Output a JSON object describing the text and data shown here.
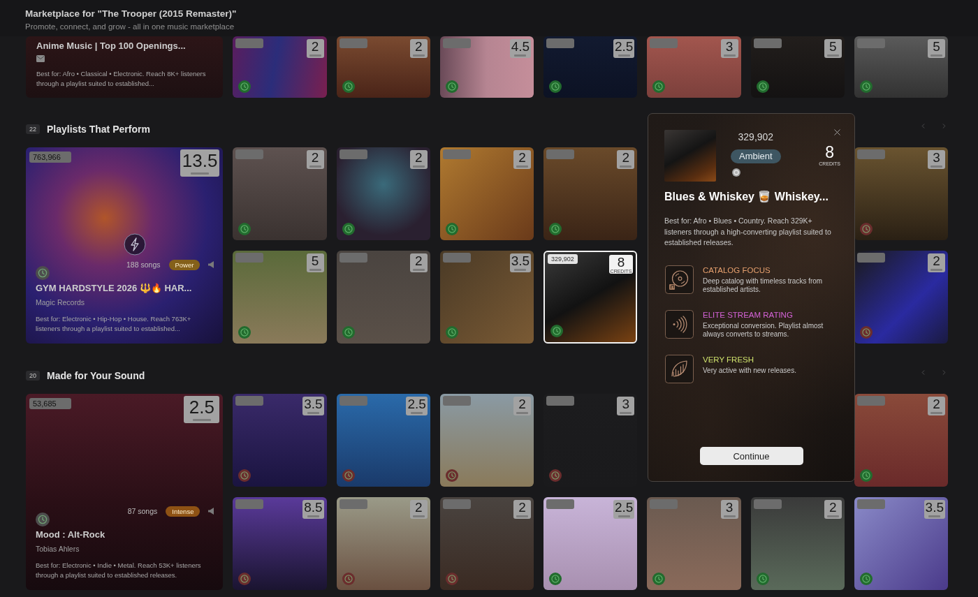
{
  "header": {
    "title": "Marketplace for \"The Trooper (2015 Remaster)\"",
    "subtitle": "Promote, connect, and grow - all in one music marketplace"
  },
  "top_row": {
    "feature": {
      "title": "Anime Music | Top 100 Openings...",
      "description": "Best for: Afro • Classical • Electronic. Reach 8K+ listeners through a playlist suited to established...",
      "selected": false
    },
    "cards": [
      {
        "credits": "2",
        "color": "#226b2e",
        "selected": false
      },
      {
        "credits": "2",
        "color": "#226b2e",
        "selected": false
      },
      {
        "credits": "4.5",
        "color": "#226b2e",
        "selected": false
      },
      {
        "credits": "2.5",
        "color": "#226b2e",
        "selected": false
      },
      {
        "credits": "3",
        "color": "#226b2e",
        "selected": false
      },
      {
        "credits": "5",
        "color": "#226b2e",
        "selected": false
      },
      {
        "credits": "5",
        "color": "#226b2e",
        "selected": false
      }
    ]
  },
  "sections": [
    {
      "count": "22",
      "title": "Playlists That Perform",
      "feature": {
        "count": "763,966",
        "credits": "13.5",
        "boost": true,
        "songs": "188 songs",
        "tag": {
          "label": "Power",
          "color": "#84601a"
        },
        "title": "GYM HARDSTYLE 2026 🔱🔥 HAR...",
        "owner": "Magic Records",
        "description": "Best for: Electronic • Hip-Hop • House. Reach 763K+ listeners through a playlist suited to established...",
        "color": "#4d4d4d",
        "selected": false
      },
      "rows": [
        [
          {
            "credits": "2",
            "color": "#226b2e",
            "selected": false
          },
          {
            "credits": "2",
            "color": "#226b2e",
            "selected": false
          },
          {
            "credits": "2",
            "color": "#226b2e",
            "selected": false
          },
          {
            "credits": "2",
            "color": "#226b2e",
            "selected": false
          },
          "",
          "",
          {
            "credits": "3",
            "color": "#6b2d2d",
            "selected": false
          }
        ],
        [
          {
            "credits": "5",
            "color": "#226b2e",
            "selected": false
          },
          {
            "credits": "2",
            "color": "#226b2e",
            "selected": false
          },
          {
            "credits": "3.5",
            "color": "#226b2e",
            "selected": false
          },
          {
            "count": "329,902",
            "credits": "8",
            "unit": "CREDITS",
            "color": "#226b2e",
            "selected": true
          },
          "",
          "",
          {
            "credits": "2",
            "color": "#6b2d2d",
            "selected": false
          }
        ]
      ]
    },
    {
      "count": "20",
      "title": "Made for Your Sound",
      "feature": {
        "count": "53,685",
        "credits": "2.5",
        "boost": false,
        "songs": "87 songs",
        "tag": {
          "label": "Intense",
          "color": "#8e5214"
        },
        "title": "Mood : Alt-Rock",
        "owner": "Tobias Ahlers",
        "description": "Best for: Electronic • Indie • Metal. Reach 53K+ listeners through a playlist suited to established releases.",
        "color": "#4d4d4d",
        "selected": false
      },
      "rows": [
        [
          {
            "credits": "3.5",
            "color": "#6b2d2d",
            "selected": false
          },
          {
            "credits": "2.5",
            "color": "#6b2d2d",
            "selected": false
          },
          {
            "credits": "2",
            "color": "#6b2d2d",
            "selected": false
          },
          {
            "credits": "3",
            "color": "#6b2d2d",
            "selected": false
          },
          "",
          "",
          {
            "credits": "2",
            "color": "#226b2e",
            "selected": false
          }
        ],
        [
          {
            "credits": "8.5",
            "color": "#6b2d2d",
            "selected": false
          },
          {
            "credits": "2",
            "color": "#6b2d2d",
            "selected": false
          },
          {
            "credits": "2",
            "color": "#6b2d2d",
            "selected": false
          },
          {
            "credits": "2.5",
            "color": "#226b2e",
            "selected": false
          },
          {
            "credits": "3",
            "color": "#226b2e",
            "selected": false
          },
          {
            "credits": "2",
            "color": "#226b2e",
            "selected": false
          },
          {
            "credits": "3.5",
            "color": "#226b2e",
            "selected": false
          }
        ]
      ]
    }
  ],
  "modal": {
    "count": "329,902",
    "genre": "Ambient",
    "credits": "8",
    "unit": "CREDITS",
    "title": "Blues & Whiskey 🥃 Whiskey...",
    "description": "Best for: Afro • Blues • Country. Reach 329K+ listeners through a high-converting playlist suited to established releases.",
    "features": [
      {
        "kind": "catalog",
        "title": "CATALOG FOCUS",
        "description": "Deep catalog with timeless tracks from established artists.",
        "color": "#e6a06e"
      },
      {
        "kind": "rating",
        "title": "ELITE STREAM RATING",
        "description": "Exceptional conversion. Playlist almost always converts to streams.",
        "color": "#d563d8"
      },
      {
        "kind": "fresh",
        "title": "VERY FRESH",
        "description": "Very active with new releases.",
        "color": "#cde06c"
      }
    ],
    "button": "Continue"
  }
}
